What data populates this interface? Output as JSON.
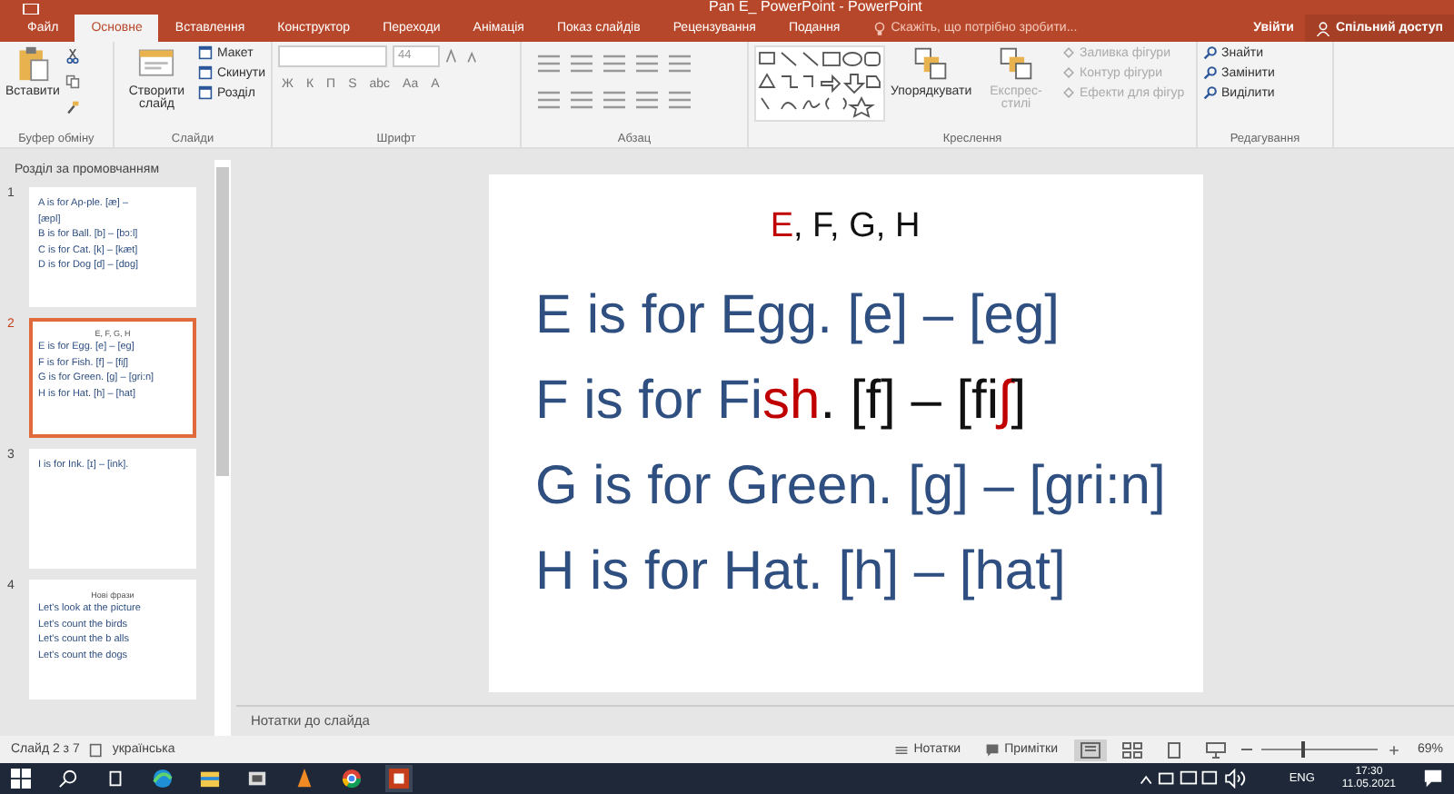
{
  "window": {
    "title": "Pan E_ PowerPoint - PowerPoint"
  },
  "tabs": [
    {
      "label": "Файл",
      "selected": false
    },
    {
      "label": "Основне",
      "selected": true
    },
    {
      "label": "Вставлення",
      "selected": false
    },
    {
      "label": "Конструктор",
      "selected": false
    },
    {
      "label": "Переходи",
      "selected": false
    },
    {
      "label": "Анімація",
      "selected": false
    },
    {
      "label": "Показ слайдів",
      "selected": false
    },
    {
      "label": "Рецензування",
      "selected": false
    },
    {
      "label": "Подання",
      "selected": false
    }
  ],
  "tell_me": {
    "placeholder": "Скажіть, що потрібно зробити..."
  },
  "account": {
    "sign_in": "Увійти",
    "share": "Спільний доступ"
  },
  "ribbon": [
    {
      "kind": "clipboard",
      "label": "Буфер обміну",
      "controls": [
        {
          "kind": "large",
          "label": "Вставити"
        }
      ]
    },
    {
      "kind": "slides",
      "label": "Слайди",
      "controls": [
        {
          "kind": "large",
          "label": "Створити слайд"
        },
        {
          "kind": "small",
          "label": "Макет"
        },
        {
          "kind": "small",
          "label": "Скинути"
        },
        {
          "kind": "small",
          "label": "Розділ"
        }
      ]
    },
    {
      "kind": "font",
      "label": "Шрифт",
      "controls": [
        {
          "kind": "field",
          "label": "44"
        },
        {
          "kind": "glyph",
          "label": "Ж"
        },
        {
          "kind": "glyph",
          "label": "К"
        },
        {
          "kind": "glyph",
          "label": "П"
        },
        {
          "kind": "glyph",
          "label": "S"
        },
        {
          "kind": "glyph",
          "label": "abc"
        },
        {
          "kind": "glyph",
          "label": "Aa"
        },
        {
          "kind": "glyph",
          "label": "A"
        }
      ]
    },
    {
      "kind": "paragraph",
      "label": "Абзац"
    },
    {
      "kind": "drawing",
      "label": "Креслення",
      "controls": [
        {
          "kind": "large",
          "label": "Упорядкувати",
          "disabled": false
        },
        {
          "kind": "large",
          "label": "Експрес-стилі",
          "disabled": true
        },
        {
          "kind": "small",
          "label": "Заливка фігури",
          "disabled": true
        },
        {
          "kind": "small",
          "label": "Контур фігури",
          "disabled": true
        },
        {
          "kind": "small",
          "label": "Ефекти для фігур",
          "disabled": true
        }
      ]
    },
    {
      "kind": "editing",
      "label": "Редагування",
      "controls": [
        {
          "kind": "small",
          "label": "Знайти"
        },
        {
          "kind": "small",
          "label": "Замінити"
        },
        {
          "kind": "small",
          "label": "Виділити"
        }
      ]
    }
  ],
  "section": "Розділ за промовчанням",
  "thumbnails": [
    {
      "number": "1",
      "selected": false,
      "lines": [
        "A is for Ap-ple. [æ] –",
        "[æpl]",
        "B is for Ball. [b] – [bɔ:l]",
        "C is for Cat. [k] – [kæt]",
        "D is for Dog [d] – [dɒg]"
      ]
    },
    {
      "number": "2",
      "selected": true,
      "title": "E, F, G, H",
      "lines": [
        "E is for Egg. [e] – [eg]",
        "F is for Fish. [f] – [fiʃ]",
        "G is for Green. [g] – [gri:n]",
        "H is for Hat. [h] – [hat]"
      ]
    },
    {
      "number": "3",
      "selected": false,
      "lines": [
        "I is for Ink. [ɪ] – [ink]."
      ]
    },
    {
      "number": "4",
      "selected": false,
      "title": "Нові фрази",
      "lines": [
        "Let's look at the picture",
        "Let's count the birds",
        "Let's count the b alls",
        "Let's count the dogs"
      ]
    }
  ],
  "slide": {
    "title": [
      {
        "text": "E",
        "color": "#c00000"
      },
      {
        "text": ", F, G, H",
        "color": "#111111"
      }
    ],
    "lines": [
      [
        {
          "text": "E is for Egg. [e] – [eg]",
          "color": "#2f4f80"
        }
      ],
      [
        {
          "text": "F is for Fi",
          "color": "#2f4f80"
        },
        {
          "text": "sh",
          "color": "#c00000"
        },
        {
          "text": ". [f] – [fi",
          "color": "#111111"
        },
        {
          "text": "ʃ",
          "color": "#c00000"
        },
        {
          "text": "]",
          "color": "#111111"
        }
      ],
      [
        {
          "text": "G is for Green. [g] – [gri:n]",
          "color": "#2f4f80"
        }
      ],
      [
        {
          "text": "H is for Hat. [h] – [hat]",
          "color": "#2f4f80"
        }
      ]
    ]
  },
  "notes": {
    "placeholder": "Нотатки до слайда"
  },
  "status_bar": {
    "slide": "Слайд 2 з 7",
    "language": "українська",
    "notes": "Нотатки",
    "comments": "Примітки",
    "zoom": "69%",
    "level": 0.35
  },
  "tray": {
    "language": "ENG",
    "time": "17:30",
    "date": "11.05.2021"
  }
}
